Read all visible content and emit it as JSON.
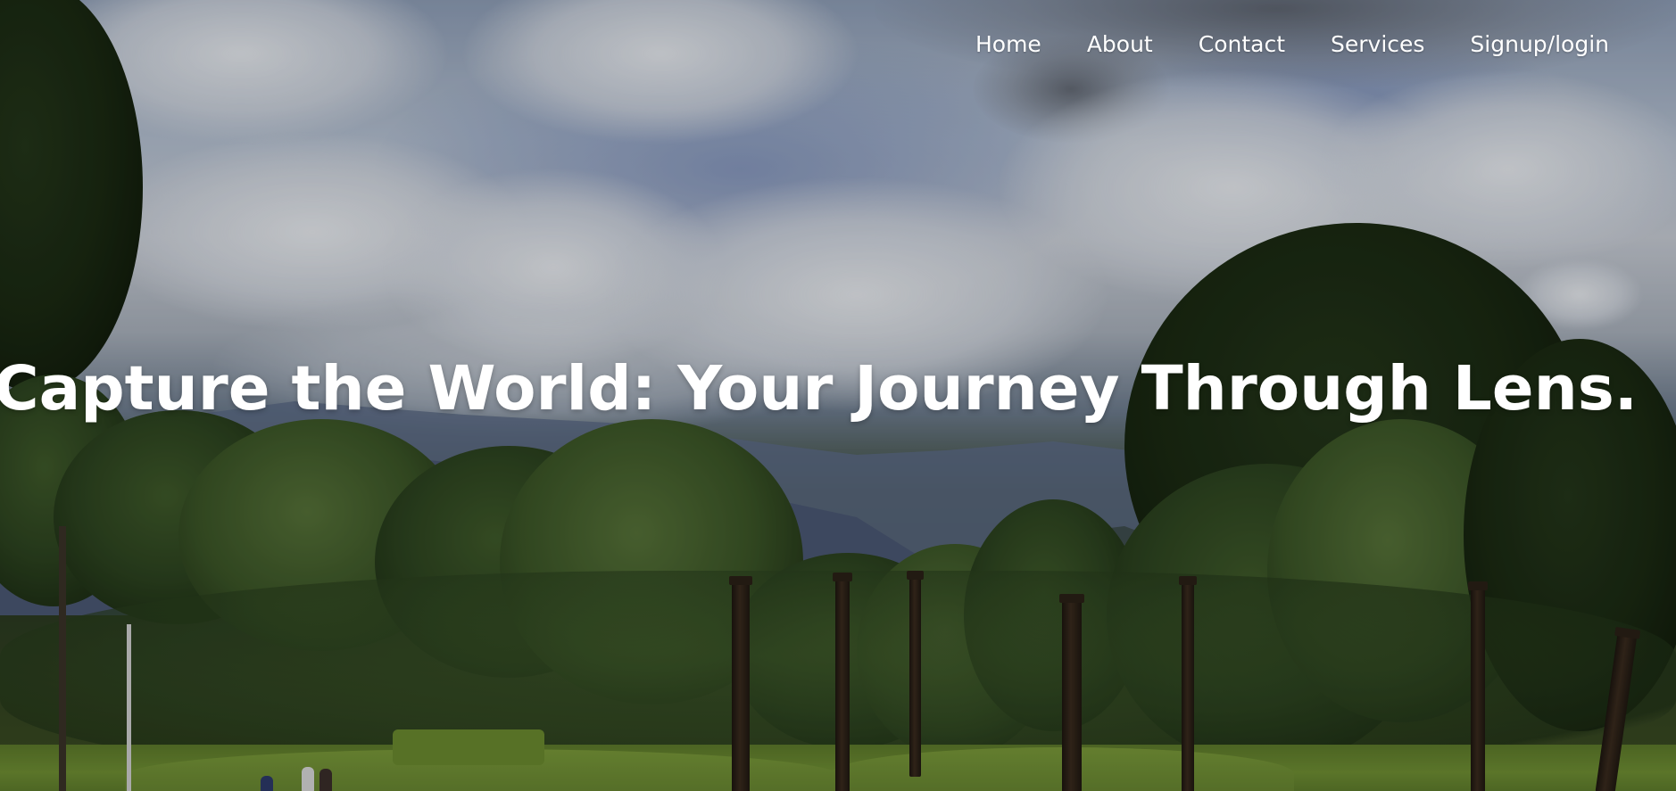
{
  "nav": {
    "items": [
      {
        "label": "Home"
      },
      {
        "label": "About"
      },
      {
        "label": "Contact"
      },
      {
        "label": "Services"
      },
      {
        "label": "Signup/login"
      }
    ]
  },
  "hero": {
    "headline": "Capture the World: Your Journey Through Lens."
  }
}
